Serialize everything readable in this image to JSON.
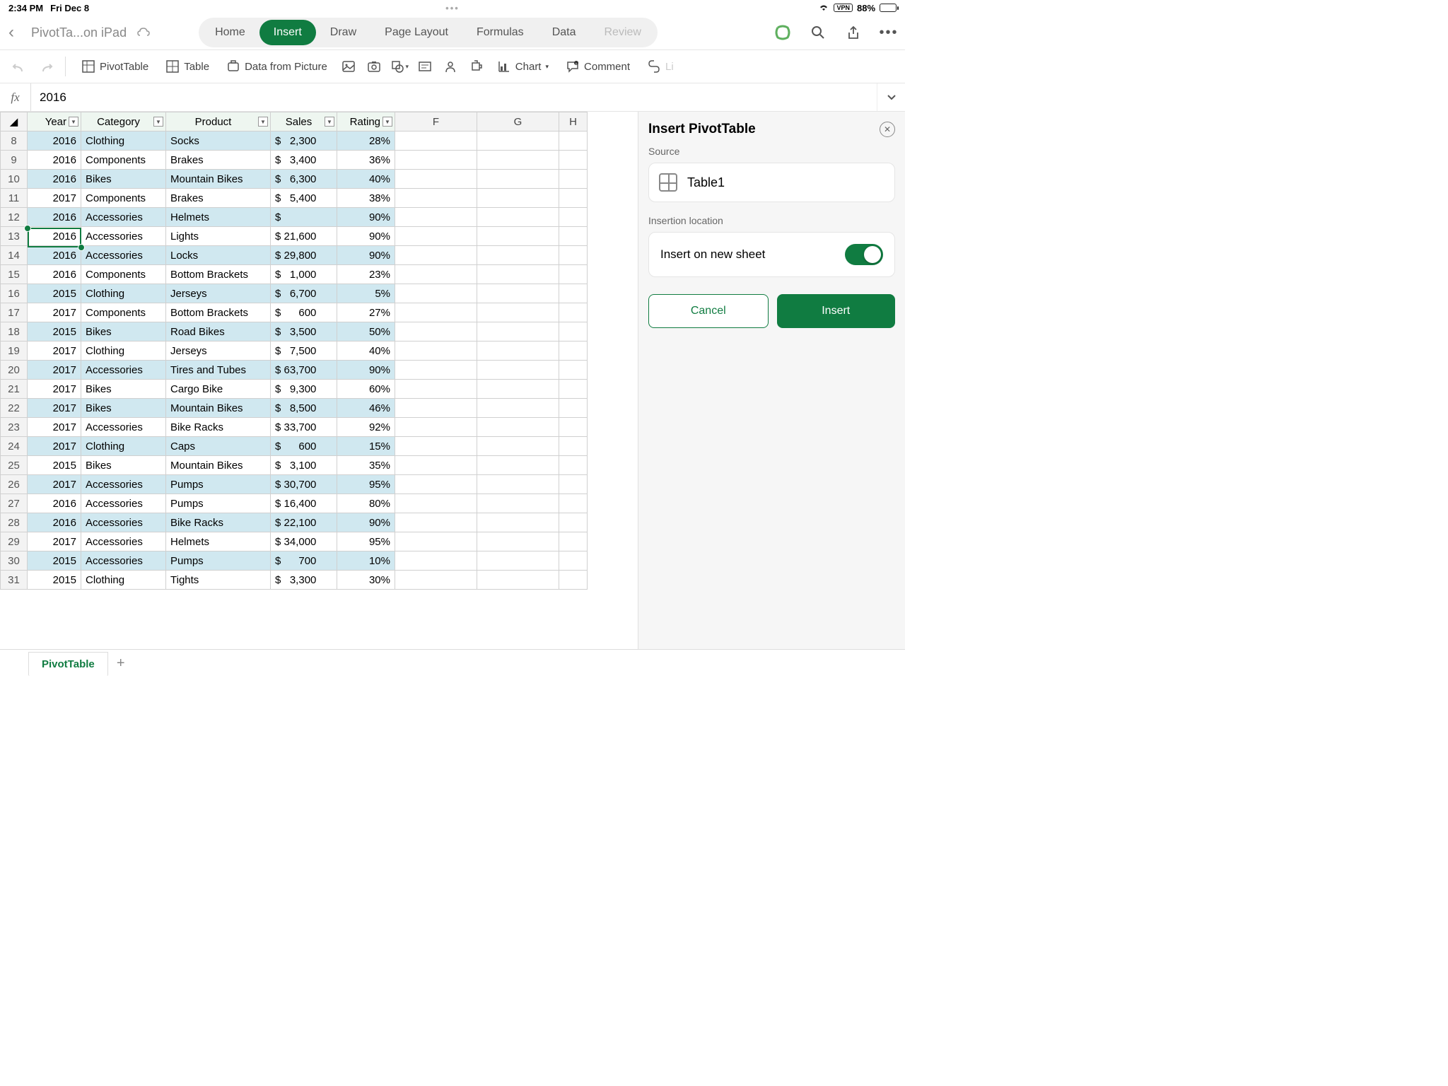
{
  "status": {
    "time": "2:34 PM",
    "date": "Fri Dec 8",
    "vpn": "VPN",
    "battery": "88%"
  },
  "doc": {
    "title": "PivotTa...on iPad"
  },
  "tabs": {
    "t0": "Home",
    "t1": "Insert",
    "t2": "Draw",
    "t3": "Page Layout",
    "t4": "Formulas",
    "t5": "Data",
    "t6": "Review"
  },
  "ribbon": {
    "pivottable": "PivotTable",
    "table": "Table",
    "datapic": "Data from Picture",
    "chart": "Chart",
    "comment": "Comment",
    "link": "Li"
  },
  "formula": {
    "fx": "fx",
    "value": "2016"
  },
  "headers": {
    "year": "Year",
    "category": "Category",
    "product": "Product",
    "sales": "Sales",
    "rating": "Rating",
    "f": "F",
    "g": "G",
    "h": "H"
  },
  "rows": [
    {
      "n": "8",
      "year": "2016",
      "cat": "Clothing",
      "prod": "Socks",
      "sales": "$   2,300",
      "rating": "28%"
    },
    {
      "n": "9",
      "year": "2016",
      "cat": "Components",
      "prod": "Brakes",
      "sales": "$   3,400",
      "rating": "36%"
    },
    {
      "n": "10",
      "year": "2016",
      "cat": "Bikes",
      "prod": "Mountain Bikes",
      "sales": "$   6,300",
      "rating": "40%"
    },
    {
      "n": "11",
      "year": "2017",
      "cat": "Components",
      "prod": "Brakes",
      "sales": "$   5,400",
      "rating": "38%"
    },
    {
      "n": "12",
      "year": "2016",
      "cat": "Accessories",
      "prod": "Helmets",
      "sales": "$",
      "rating": "90%"
    },
    {
      "n": "13",
      "year": "2016",
      "cat": "Accessories",
      "prod": "Lights",
      "sales": "$ 21,600",
      "rating": "90%"
    },
    {
      "n": "14",
      "year": "2016",
      "cat": "Accessories",
      "prod": "Locks",
      "sales": "$ 29,800",
      "rating": "90%"
    },
    {
      "n": "15",
      "year": "2016",
      "cat": "Components",
      "prod": "Bottom Brackets",
      "sales": "$   1,000",
      "rating": "23%"
    },
    {
      "n": "16",
      "year": "2015",
      "cat": "Clothing",
      "prod": "Jerseys",
      "sales": "$   6,700",
      "rating": "5%"
    },
    {
      "n": "17",
      "year": "2017",
      "cat": "Components",
      "prod": "Bottom Brackets",
      "sales": "$      600",
      "rating": "27%"
    },
    {
      "n": "18",
      "year": "2015",
      "cat": "Bikes",
      "prod": "Road Bikes",
      "sales": "$   3,500",
      "rating": "50%"
    },
    {
      "n": "19",
      "year": "2017",
      "cat": "Clothing",
      "prod": "Jerseys",
      "sales": "$   7,500",
      "rating": "40%"
    },
    {
      "n": "20",
      "year": "2017",
      "cat": "Accessories",
      "prod": "Tires and Tubes",
      "sales": "$ 63,700",
      "rating": "90%"
    },
    {
      "n": "21",
      "year": "2017",
      "cat": "Bikes",
      "prod": "Cargo Bike",
      "sales": "$   9,300",
      "rating": "60%"
    },
    {
      "n": "22",
      "year": "2017",
      "cat": "Bikes",
      "prod": "Mountain Bikes",
      "sales": "$   8,500",
      "rating": "46%"
    },
    {
      "n": "23",
      "year": "2017",
      "cat": "Accessories",
      "prod": "Bike Racks",
      "sales": "$ 33,700",
      "rating": "92%"
    },
    {
      "n": "24",
      "year": "2017",
      "cat": "Clothing",
      "prod": "Caps",
      "sales": "$      600",
      "rating": "15%"
    },
    {
      "n": "25",
      "year": "2015",
      "cat": "Bikes",
      "prod": "Mountain Bikes",
      "sales": "$   3,100",
      "rating": "35%"
    },
    {
      "n": "26",
      "year": "2017",
      "cat": "Accessories",
      "prod": "Pumps",
      "sales": "$ 30,700",
      "rating": "95%"
    },
    {
      "n": "27",
      "year": "2016",
      "cat": "Accessories",
      "prod": "Pumps",
      "sales": "$ 16,400",
      "rating": "80%"
    },
    {
      "n": "28",
      "year": "2016",
      "cat": "Accessories",
      "prod": "Bike Racks",
      "sales": "$ 22,100",
      "rating": "90%"
    },
    {
      "n": "29",
      "year": "2017",
      "cat": "Accessories",
      "prod": "Helmets",
      "sales": "$ 34,000",
      "rating": "95%"
    },
    {
      "n": "30",
      "year": "2015",
      "cat": "Accessories",
      "prod": "Pumps",
      "sales": "$      700",
      "rating": "10%"
    },
    {
      "n": "31",
      "year": "2015",
      "cat": "Clothing",
      "prod": "Tights",
      "sales": "$   3,300",
      "rating": "30%"
    }
  ],
  "panel": {
    "title": "Insert PivotTable",
    "source_label": "Source",
    "source_name": "Table1",
    "insertion_label": "Insertion location",
    "insert_new": "Insert on new sheet",
    "cancel": "Cancel",
    "insert": "Insert"
  },
  "sheets": {
    "tab1": "PivotTable"
  }
}
